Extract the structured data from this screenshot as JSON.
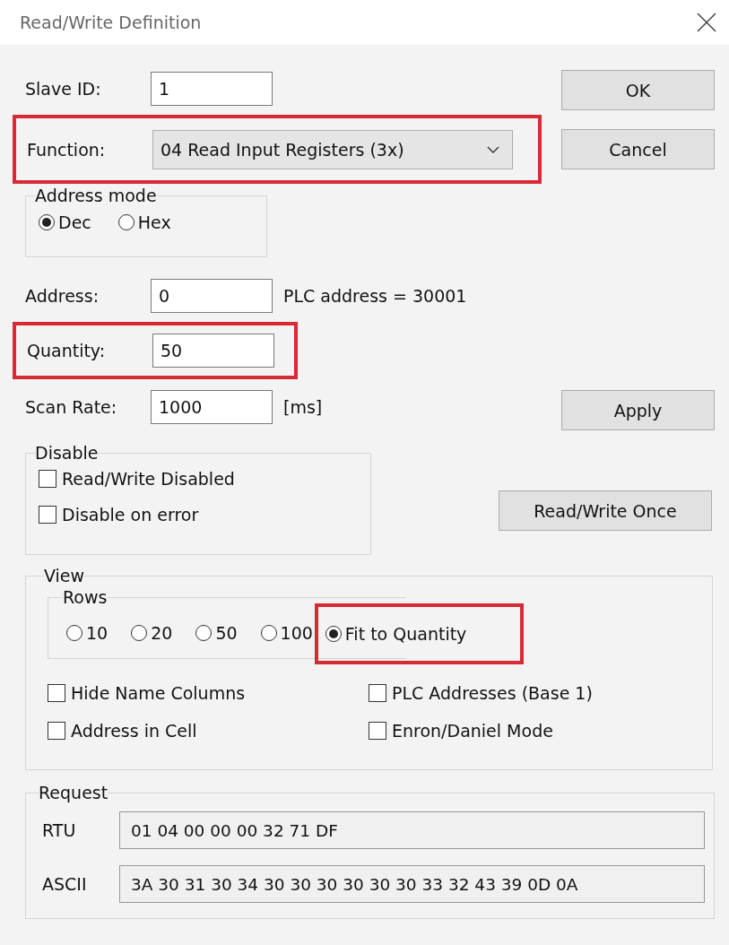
{
  "window": {
    "title": "Read/Write Definition"
  },
  "slave_id": {
    "label": "Slave ID:",
    "value": "1"
  },
  "function": {
    "label": "Function:",
    "value": "04 Read Input Registers (3x)",
    "highlighted": true
  },
  "address_mode": {
    "title": "Address mode",
    "options": [
      {
        "label": "Dec",
        "selected": true
      },
      {
        "label": "Hex",
        "selected": false
      }
    ]
  },
  "address": {
    "label": "Address:",
    "value": "0",
    "note": "PLC address = 30001"
  },
  "quantity": {
    "label": "Quantity:",
    "value": "50",
    "highlighted": true
  },
  "scan_rate": {
    "label": "Scan Rate:",
    "value": "1000",
    "unit": "[ms]"
  },
  "buttons": {
    "ok": "OK",
    "cancel": "Cancel",
    "apply": "Apply",
    "once": "Read/Write Once"
  },
  "disable": {
    "title": "Disable",
    "options": [
      {
        "label": "Read/Write Disabled",
        "checked": false
      },
      {
        "label": "Disable on error",
        "checked": false
      }
    ]
  },
  "view": {
    "title": "View",
    "rows": {
      "title": "Rows",
      "options": [
        {
          "label": "10",
          "selected": false,
          "highlighted": false
        },
        {
          "label": "20",
          "selected": false,
          "highlighted": false
        },
        {
          "label": "50",
          "selected": false,
          "highlighted": false
        },
        {
          "label": "100",
          "selected": false,
          "highlighted": false
        },
        {
          "label": "Fit to Quantity",
          "selected": true,
          "highlighted": true
        }
      ]
    },
    "options": [
      {
        "label": "Hide Name Columns",
        "checked": false
      },
      {
        "label": "PLC Addresses (Base 1)",
        "checked": false
      },
      {
        "label": "Address in Cell",
        "checked": false
      },
      {
        "label": "Enron/Daniel Mode",
        "checked": false
      }
    ]
  },
  "request": {
    "title": "Request",
    "fields": [
      {
        "label": "RTU",
        "value": "01 04 00 00 00 32 71 DF"
      },
      {
        "label": "ASCII",
        "value": "3A 30 31 30 34 30 30 30 30 30 30 33 32 43 39 0D 0A"
      }
    ]
  }
}
